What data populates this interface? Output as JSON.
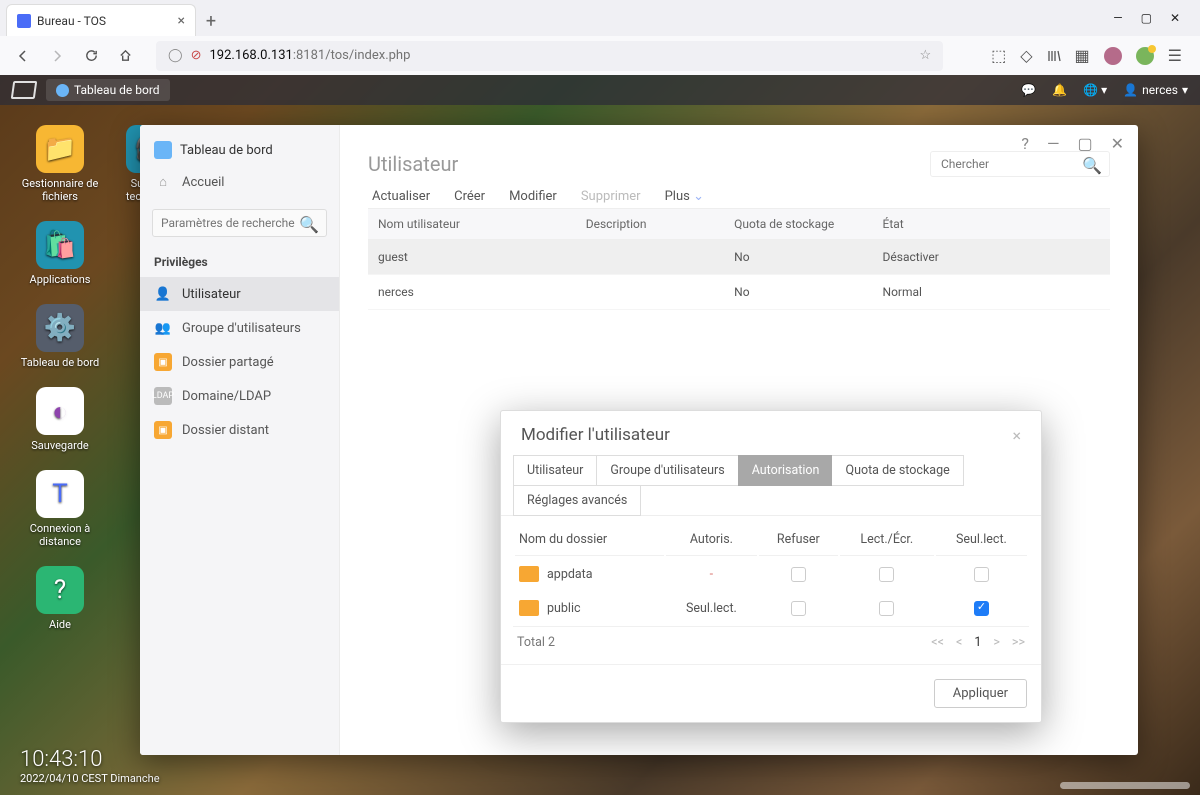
{
  "browser": {
    "tab_title": "Bureau - TOS",
    "url_host": "192.168.0.131",
    "url_port_path": ":8181/tos/index.php"
  },
  "tos_topbar": {
    "dashboard": "Tableau de bord",
    "user": "nerces"
  },
  "desktop_icons": {
    "files": "Gestionnaire de fichiers",
    "support": "Support technique",
    "apps": "Applications",
    "dashboard": "Tableau de bord",
    "backup": "Sauvegarde",
    "remote": "Connexion à distance",
    "help": "Aide"
  },
  "clock": {
    "time": "10:43:10",
    "date": "2022/04/10 CEST Dimanche"
  },
  "sidebar": {
    "window_title": "Tableau de bord",
    "home": "Accueil",
    "search_placeholder": "Paramètres de recherche",
    "group_privileges": "Privilèges",
    "items": {
      "user": "Utilisateur",
      "group": "Groupe d'utilisateurs",
      "shared": "Dossier partagé",
      "ldap": "Domaine/LDAP",
      "remote": "Dossier distant"
    }
  },
  "main": {
    "title": "Utilisateur",
    "search_placeholder": "Chercher",
    "toolbar": {
      "refresh": "Actualiser",
      "create": "Créer",
      "edit": "Modifier",
      "delete": "Supprimer",
      "more": "Plus"
    },
    "columns": {
      "name": "Nom utilisateur",
      "desc": "Description",
      "quota": "Quota de stockage",
      "state": "État"
    },
    "rows": [
      {
        "name": "guest",
        "desc": "",
        "quota": "No",
        "state": "Désactiver",
        "state_class": "status-disabled"
      },
      {
        "name": "nerces",
        "desc": "",
        "quota": "No",
        "state": "Normal",
        "state_class": ""
      }
    ]
  },
  "modal": {
    "title": "Modifier l'utilisateur",
    "tabs": {
      "user": "Utilisateur",
      "group": "Groupe d'utilisateurs",
      "auth": "Autorisation",
      "quota": "Quota de stockage",
      "advanced": "Réglages avancés"
    },
    "columns": {
      "folder": "Nom du dossier",
      "autoris": "Autoris.",
      "refuse": "Refuser",
      "rw": "Lect./Écr.",
      "ro": "Seul.lect."
    },
    "rows": [
      {
        "folder": "appdata",
        "autoris": "-",
        "refuse": false,
        "rw": false,
        "ro": false
      },
      {
        "folder": "public",
        "autoris": "Seul.lect.",
        "refuse": false,
        "rw": false,
        "ro": true
      }
    ],
    "total": "Total 2",
    "page": "1",
    "apply": "Appliquer"
  }
}
